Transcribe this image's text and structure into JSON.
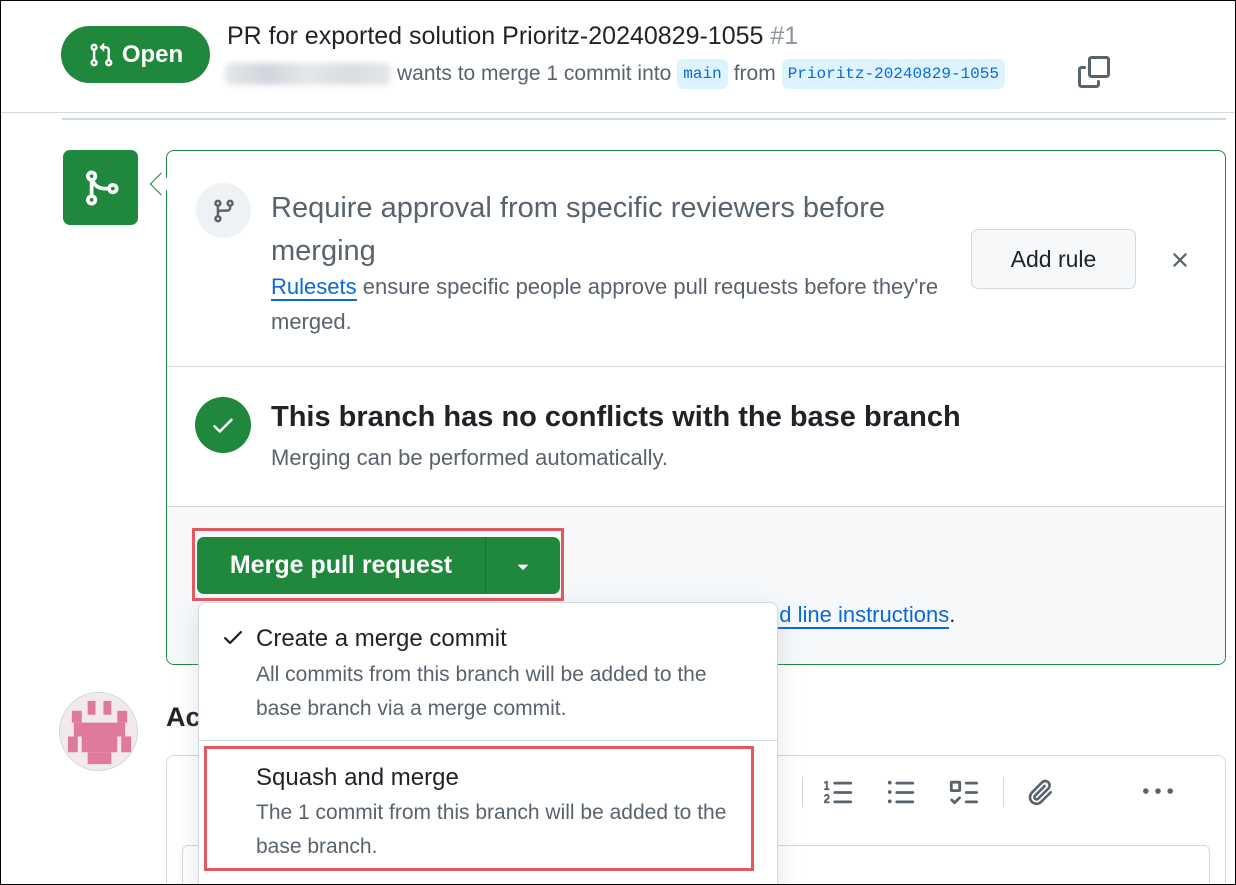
{
  "pr": {
    "state": "Open",
    "title": "PR for exported solution Prioritz-20240829-1055",
    "number": "#1",
    "meta_text": "wants to merge 1 commit into",
    "base_branch": "main",
    "from_text": "from",
    "head_branch": "Prioritz-20240829-1055"
  },
  "rules_notice": {
    "title": "Require approval from specific reviewers before merging",
    "link": "Rulesets",
    "desc": "ensure specific people approve pull requests before they're merged.",
    "add_rule_label": "Add rule"
  },
  "conflicts": {
    "title": "This branch has no conflicts with the base branch",
    "desc": "Merging can be performed automatically."
  },
  "merge": {
    "button_label": "Merge pull request",
    "cli_link": "nd line instructions",
    "cli_suffix": "."
  },
  "dropdown": {
    "items": [
      {
        "title": "Create a merge commit",
        "desc": "All commits from this branch will be added to the base branch via a merge commit.",
        "selected": true
      },
      {
        "title": "Squash and merge",
        "desc": "The 1 commit from this branch will be added to the base branch.",
        "selected": false
      }
    ]
  },
  "comment": {
    "heading": "Ac"
  },
  "icons": {
    "state": "git-pull-request-icon",
    "copy": "copy-icon",
    "merge": "git-merge-icon",
    "rules": "git-branch-icon",
    "close": "x-icon",
    "check": "check-icon",
    "caret": "triangle-down-icon",
    "toolbar": [
      "mention-icon",
      "ordered-list-icon",
      "unordered-list-icon",
      "tasklist-icon",
      "paperclip-icon",
      "kebab-horizontal-icon"
    ]
  },
  "colors": {
    "primary_green": "#1f883d",
    "link_blue": "#0969da",
    "branch_bg": "#ddf4ff",
    "highlight_red": "#e05a5f"
  }
}
